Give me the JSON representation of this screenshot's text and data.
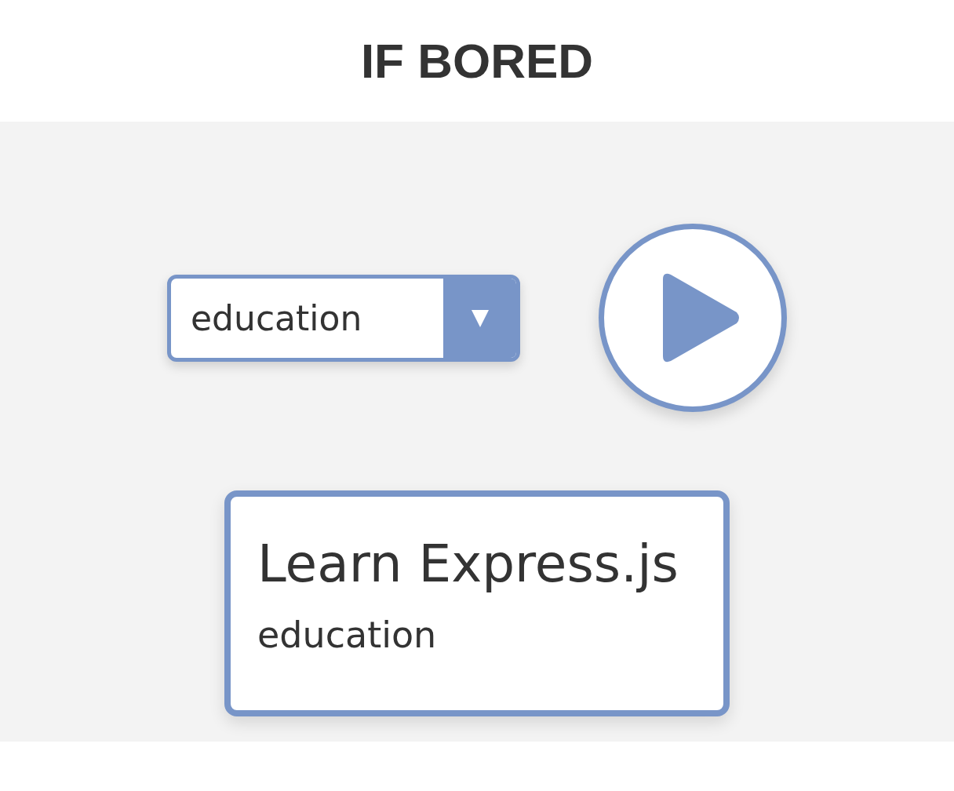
{
  "header": {
    "title": "IF BORED"
  },
  "category_select": {
    "value": "education"
  },
  "activity_card": {
    "title": "Learn Express.js",
    "category": "education"
  }
}
